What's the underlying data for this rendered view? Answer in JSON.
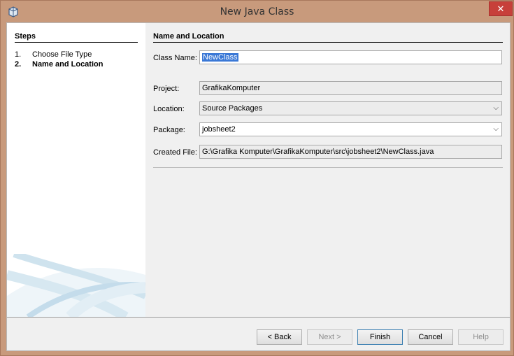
{
  "window": {
    "title": "New Java Class",
    "close_glyph": "✕",
    "app_icon": "java-class-wizard-icon"
  },
  "steps": {
    "title": "Steps",
    "items": [
      {
        "num": "1.",
        "label": "Choose File Type"
      },
      {
        "num": "2.",
        "label": "Name and Location"
      }
    ]
  },
  "form": {
    "section_title": "Name and Location",
    "class_name_label": "Class Name:",
    "class_name_value": "NewClass",
    "project_label": "Project:",
    "project_value": "GrafikaKomputer",
    "location_label": "Location:",
    "location_value": "Source Packages",
    "package_label": "Package:",
    "package_value": "jobsheet2",
    "created_file_label": "Created File:",
    "created_file_value": "G:\\Grafika Komputer\\GrafikaKomputer\\src\\jobsheet2\\NewClass.java",
    "dropdown_glyph": "⌵"
  },
  "buttons": {
    "back": "< Back",
    "next": "Next >",
    "finish": "Finish",
    "cancel": "Cancel",
    "help": "Help"
  },
  "colors": {
    "title_bar": "#c89a7c",
    "close_button": "#c7403a",
    "selection": "#3a78d6"
  }
}
